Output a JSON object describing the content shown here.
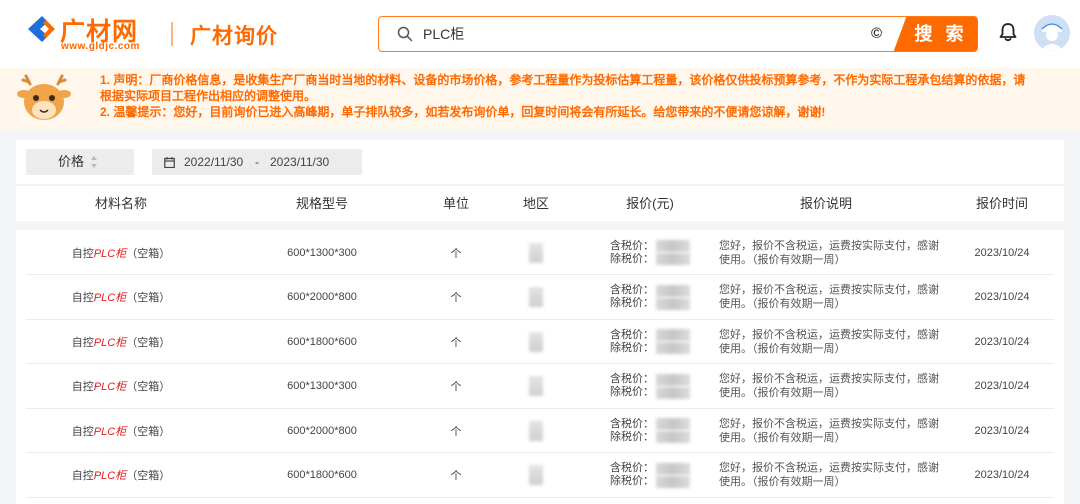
{
  "header": {
    "logo_title": "广材网",
    "logo_url": "www.gldjc.com",
    "product_name": "广材询价",
    "search_value": "PLC柜",
    "search_button": "搜 索",
    "clear_glyph": "©"
  },
  "notice": {
    "line1": "1. 声明：厂商价格信息，是收集生产厂商当时当地的材料、设备的市场价格，参考工程量作为投标估算工程量，该价格仅供投标预算参考，不作为实际工程承包结算的依据，请",
    "line2": "根据实际项目工程作出相应的调整使用。",
    "line3": "2. 温馨提示：您好，目前询价已进入高峰期，单子排队较多，如若发布询价单，回复时间将会有所延长。给您带来的不便请您谅解，谢谢!"
  },
  "filter": {
    "sort_label": "价格",
    "date_start": "2022/11/30",
    "date_sep": "-",
    "date_end": "2023/11/30"
  },
  "columns": {
    "name": "材料名称",
    "spec": "规格型号",
    "unit": "单位",
    "region": "地区",
    "price": "报价(元)",
    "desc": "报价说明",
    "time": "报价时间"
  },
  "rows": [
    {
      "name_prefix": "自控",
      "name_highlight": "PLC柜",
      "name_suffix": "（空箱）",
      "spec": "600*1300*300",
      "unit": "个",
      "tax_label": "含税价：",
      "notax_label": "除税价：",
      "desc": "您好，报价不含税运，运费按实际支付，感谢使用。（报价有效期一周）",
      "time": "2023/10/24"
    },
    {
      "name_prefix": "自控",
      "name_highlight": "PLC柜",
      "name_suffix": "（空箱）",
      "spec": "600*2000*800",
      "unit": "个",
      "tax_label": "含税价：",
      "notax_label": "除税价：",
      "desc": "您好，报价不含税运，运费按实际支付，感谢使用。（报价有效期一周）",
      "time": "2023/10/24"
    },
    {
      "name_prefix": "自控",
      "name_highlight": "PLC柜",
      "name_suffix": "（空箱）",
      "spec": "600*1800*600",
      "unit": "个",
      "tax_label": "含税价：",
      "notax_label": "除税价：",
      "desc": "您好，报价不含税运，运费按实际支付，感谢使用。（报价有效期一周）",
      "time": "2023/10/24"
    },
    {
      "name_prefix": "自控",
      "name_highlight": "PLC柜",
      "name_suffix": "（空箱）",
      "spec": "600*1300*300",
      "unit": "个",
      "tax_label": "含税价：",
      "notax_label": "除税价：",
      "desc": "您好，报价不含税运，运费按实际支付，感谢使用。（报价有效期一周）",
      "time": "2023/10/24"
    },
    {
      "name_prefix": "自控",
      "name_highlight": "PLC柜",
      "name_suffix": "（空箱）",
      "spec": "600*2000*800",
      "unit": "个",
      "tax_label": "含税价：",
      "notax_label": "除税价：",
      "desc": "您好，报价不含税运，运费按实际支付，感谢使用。（报价有效期一周）",
      "time": "2023/10/24"
    },
    {
      "name_prefix": "自控",
      "name_highlight": "PLC柜",
      "name_suffix": "（空箱）",
      "spec": "600*1800*600",
      "unit": "个",
      "tax_label": "含税价：",
      "notax_label": "除税价：",
      "desc": "您好，报价不含税运，运费按实际支付，感谢使用。（报价有效期一周）",
      "time": "2023/10/24"
    }
  ],
  "colors": {
    "brand": "#ff6a00",
    "highlight": "#e02020",
    "notice_bg": "#fff6ec"
  },
  "icons": {
    "logo": "logo-mark-icon",
    "search": "search-icon",
    "bell": "bell-icon",
    "avatar": "avatar-icon",
    "calendar": "calendar-icon",
    "sort": "sort-arrows-icon",
    "mascot": "deer-mascot-icon"
  }
}
